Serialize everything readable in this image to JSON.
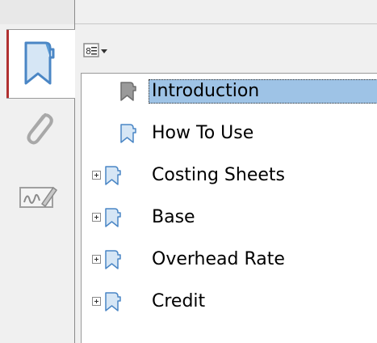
{
  "toolbar": {
    "options_icon": "bookmark-options-icon",
    "dropdown_icon": "chevron-down-icon"
  },
  "side_tabs": [
    {
      "id": "bookmarks",
      "icon": "bookmark-icon",
      "active": true
    },
    {
      "id": "attachments",
      "icon": "paperclip-icon",
      "active": false
    },
    {
      "id": "signatures",
      "icon": "signature-icon",
      "active": false
    }
  ],
  "bookmarks": [
    {
      "label": "Introduction",
      "selected": true,
      "expandable": false
    },
    {
      "label": "How To Use",
      "selected": false,
      "expandable": false
    },
    {
      "label": "Costing Sheets",
      "selected": false,
      "expandable": true
    },
    {
      "label": "Base",
      "selected": false,
      "expandable": true
    },
    {
      "label": "Overhead Rate",
      "selected": false,
      "expandable": true
    },
    {
      "label": "Credit",
      "selected": false,
      "expandable": true
    }
  ],
  "colors": {
    "selection": "#9ec3e6",
    "active_tab_edge": "#b03030",
    "bookmark_icon_blue": "#5a9bd5",
    "bookmark_icon_grey": "#8c8c8c"
  }
}
